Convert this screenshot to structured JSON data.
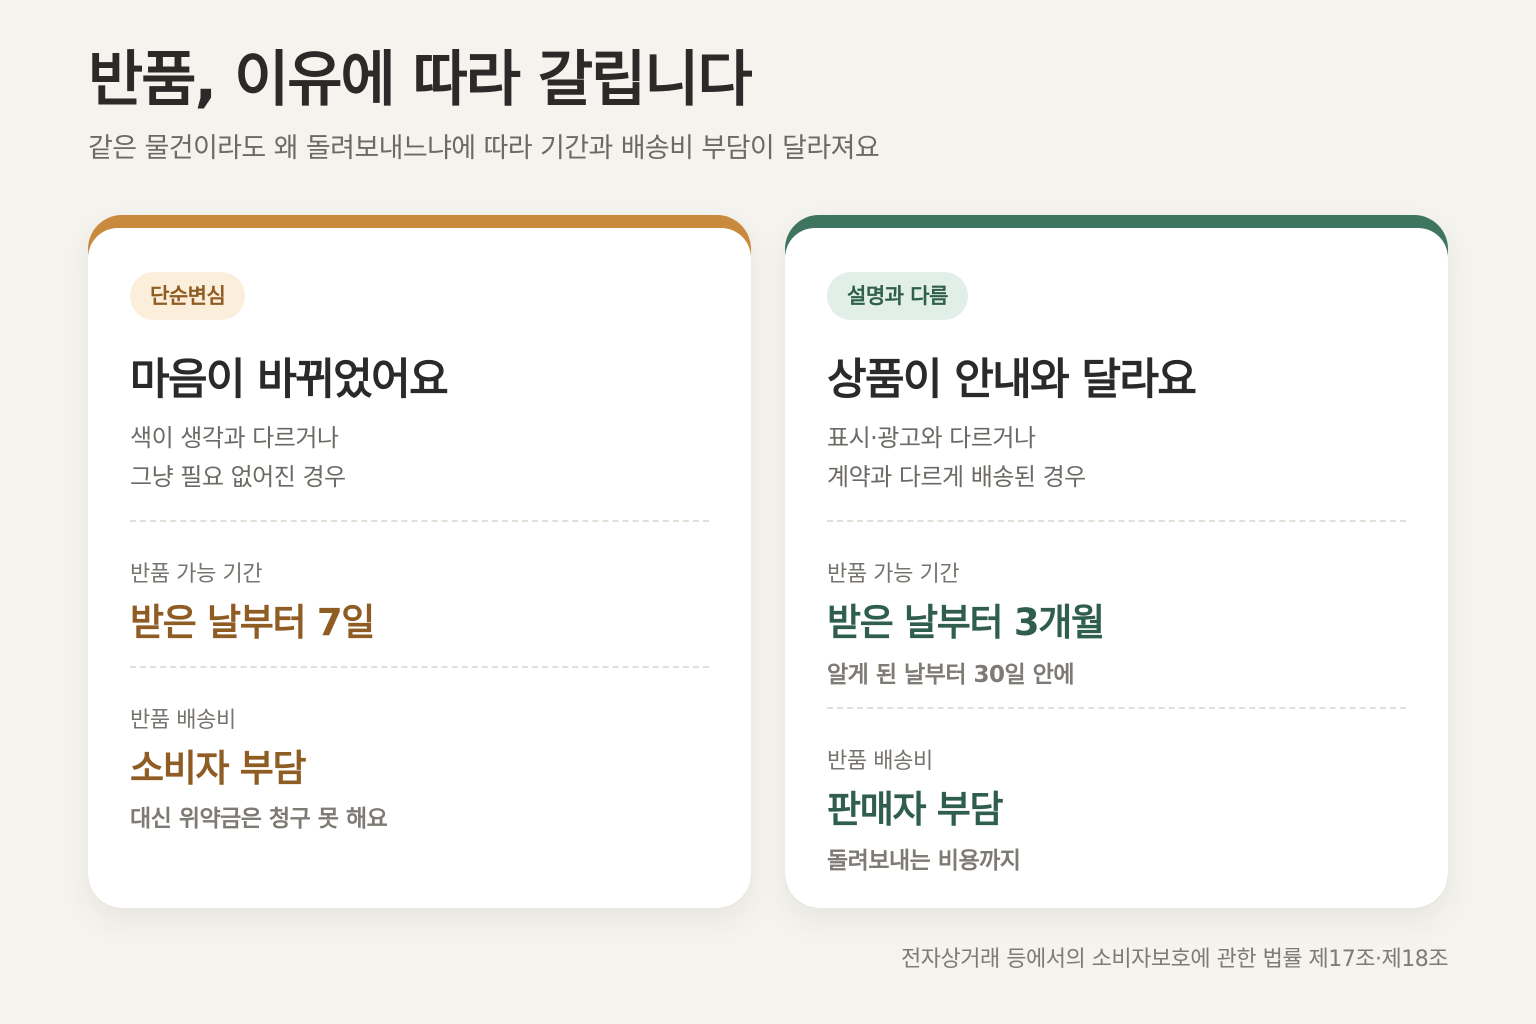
{
  "header": {
    "title": "반품, 이유에 따라 갈립니다",
    "subtitle": "같은 물건이라도 왜 돌려보내느냐에 따라 기간과 배송비 부담이 달라져요"
  },
  "cards": [
    {
      "accent_color": "#c98a3d",
      "badge": "단순변심",
      "title": "마음이 바뀌었어요",
      "description": [
        "색이 생각과 다르거나",
        "그냥 필요 없어진 경우"
      ],
      "period": {
        "label": "반품 가능 기간",
        "value": "받은 날부터 7일"
      },
      "shipping": {
        "label": "반품 배송비",
        "value": "소비자 부담",
        "note": "대신 위약금은 청구 못 해요"
      }
    },
    {
      "accent_color": "#3d7560",
      "badge": "설명과 다름",
      "title": "상품이 안내와 달라요",
      "description": [
        "표시·광고와 다르거나",
        "계약과 다르게 배송된 경우"
      ],
      "period": {
        "label": "반품 가능 기간",
        "value": "받은 날부터 3개월",
        "note": "알게 된 날부터 30일 안에"
      },
      "shipping": {
        "label": "반품 배송비",
        "value": "판매자 부담",
        "note": "돌려보내는 비용까지"
      }
    }
  ],
  "footnote": "전자상거래 등에서의 소비자보호에 관한 법률 제17조·제18조"
}
